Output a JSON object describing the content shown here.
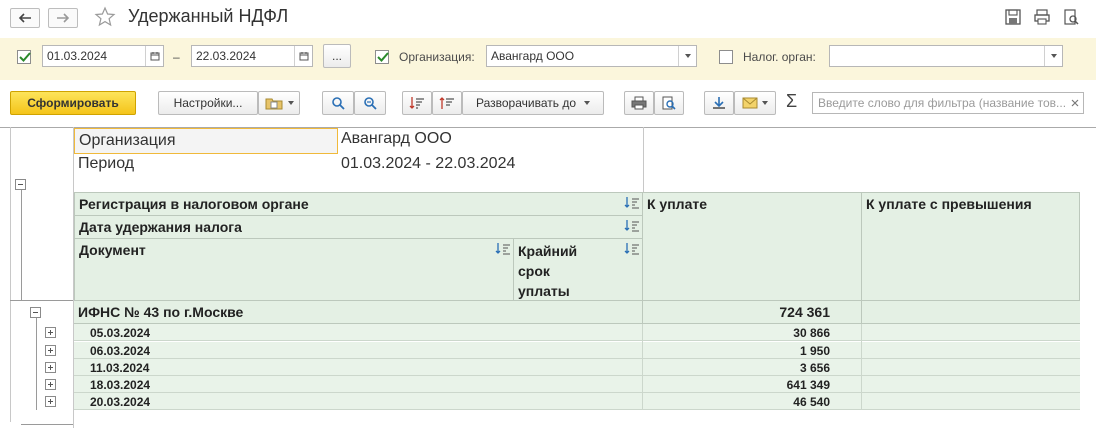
{
  "window": {
    "title": "Удержанный НДФЛ",
    "back_icon": "arrow-left-icon",
    "forward_icon": "arrow-right-icon",
    "favorite_icon": "star-icon"
  },
  "params": {
    "date_from": "01.03.2024",
    "date_sep": "–",
    "date_to": "22.03.2024",
    "more_label": "...",
    "org_label": "Организация:",
    "org_value": "Авангард ООО",
    "tax_label": "Налог. орган:",
    "tax_value": ""
  },
  "toolbar": {
    "generate": "Сформировать",
    "settings": "Настройки...",
    "expand_to": "Разворачивать до",
    "search_placeholder": "Введите слово для фильтра (название тов..."
  },
  "report": {
    "meta": [
      {
        "label": "Организация",
        "value": "Авангард ООО"
      },
      {
        "label": "Период",
        "value": "01.03.2024 - 22.03.2024"
      }
    ],
    "headers": {
      "registration": "Регистрация в налоговом органе",
      "retention_date": "Дата удержания налога",
      "document": "Документ",
      "deadline_line1": "Крайний",
      "deadline_line2": "срок",
      "deadline_line3": "уплаты",
      "to_pay": "К уплате",
      "to_pay_excess": "К уплате с превышения"
    },
    "group": {
      "name": "ИФНС № 43 по г.Москве",
      "amount": "724 361"
    },
    "rows": [
      {
        "date": "05.03.2024",
        "amount": "30 866"
      },
      {
        "date": "06.03.2024",
        "amount": "1 950"
      },
      {
        "date": "11.03.2024",
        "amount": "3 656"
      },
      {
        "date": "18.03.2024",
        "amount": "641 349"
      },
      {
        "date": "20.03.2024",
        "amount": "46 540"
      }
    ]
  }
}
